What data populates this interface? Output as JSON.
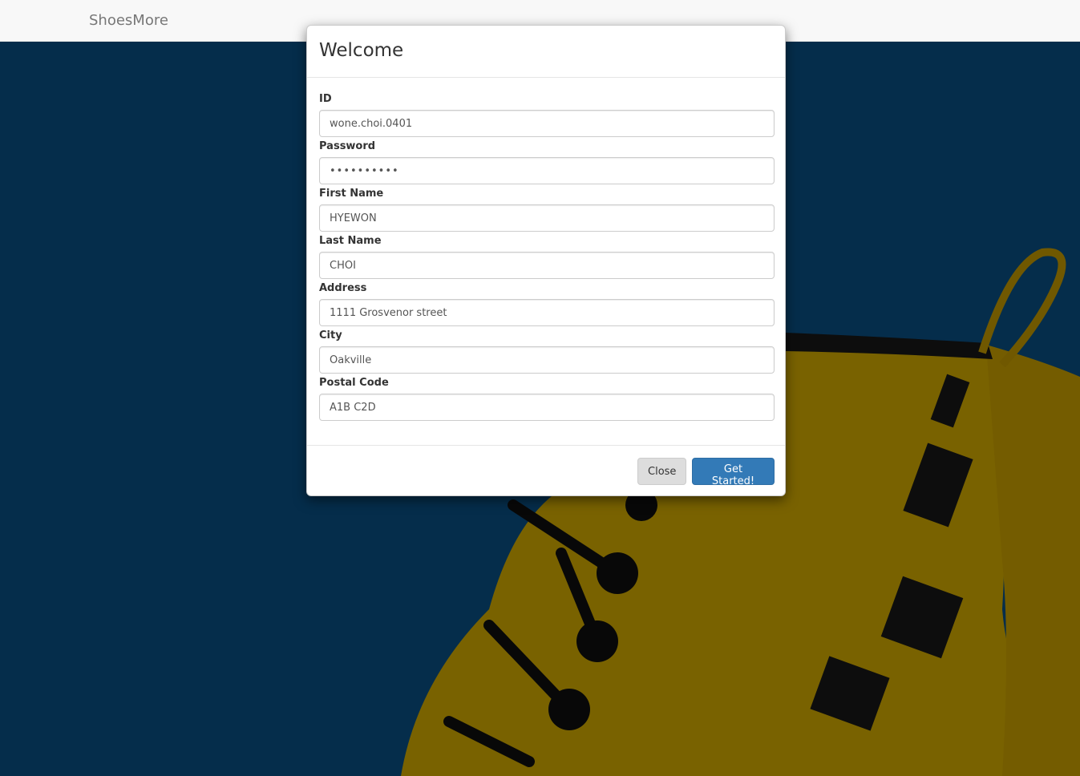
{
  "navbar": {
    "brand": "ShoesMore"
  },
  "modal": {
    "title": "Welcome",
    "fields": [
      {
        "label": "ID",
        "value": "wone.choi.0401",
        "type": "text"
      },
      {
        "label": "Password",
        "value": "••••••••••",
        "type": "password"
      },
      {
        "label": "First Name",
        "value": "HYEWON",
        "type": "text"
      },
      {
        "label": "Last Name",
        "value": "CHOI",
        "type": "text"
      },
      {
        "label": "Address",
        "value": "1111 Grosvenor street",
        "type": "text"
      },
      {
        "label": "City",
        "value": "Oakville",
        "type": "text"
      },
      {
        "label": "Postal Code",
        "value": "A1B C2D",
        "type": "text"
      }
    ],
    "close_label": "Close",
    "submit_label": "Get Started!"
  },
  "colors": {
    "background_blue": "#0b5a96",
    "boot_yellow": "#f2c400",
    "primary_button": "#337ab7"
  }
}
